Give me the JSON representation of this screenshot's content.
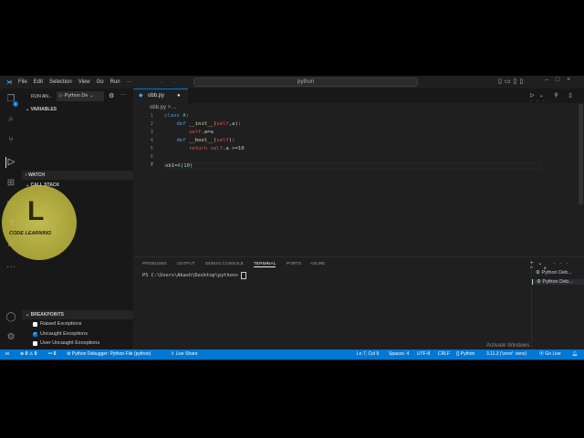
{
  "menu": [
    "File",
    "Edit",
    "Selection",
    "View",
    "Go",
    "Run",
    "···"
  ],
  "search": "python",
  "sidebar": {
    "run_label": "RUN AN...",
    "config": "Python De",
    "variables": "VARIABLES",
    "watch": "WATCH",
    "call_stack": "CALL STACK",
    "breakpoints": "BREAKPOINTS",
    "bp_items": [
      {
        "label": "Raised Exceptions",
        "checked": false
      },
      {
        "label": "Uncaught Exceptions",
        "checked": true
      },
      {
        "label": "User Uncaught Exceptions",
        "checked": false
      }
    ],
    "explorer_badge": "1"
  },
  "logo": {
    "text": "CODE LEARNING",
    "letter": "L"
  },
  "editor": {
    "tab": "obb.py",
    "breadcrumb": "obb.py > ...",
    "lines": [
      "class A:",
      "    def __init__(self,a):",
      "        self.a=a",
      "    def __bool__(self):",
      "        return self.a >=10",
      "",
      "ob1=A(10)"
    ]
  },
  "panel": {
    "tabs": [
      "PROBLEMS",
      "OUTPUT",
      "DEBUG CONSOLE",
      "TERMINAL",
      "PORTS",
      "AZURE"
    ],
    "active": "TERMINAL",
    "prompt": "PS C:\\Users\\Akash\\Desktop\\python> ",
    "terminals": [
      "Python Deb...",
      "Python Deb..."
    ]
  },
  "status": {
    "errors": "0",
    "warnings": "0",
    "ports": "0",
    "debugger": "Python Debugger: Python File (python)",
    "live_share": "Live Share",
    "position": "Ln 7, Col 9",
    "spaces": "Spaces: 4",
    "encoding": "UTF-8",
    "eol": "CRLF",
    "language": "Python",
    "interpreter": "3.11.3 ('venv': venv)",
    "go_live": "Go Live",
    "watermark": "Activate Windows"
  },
  "colors": {
    "accent": "#0078d4",
    "logo": "#c8c24a"
  }
}
